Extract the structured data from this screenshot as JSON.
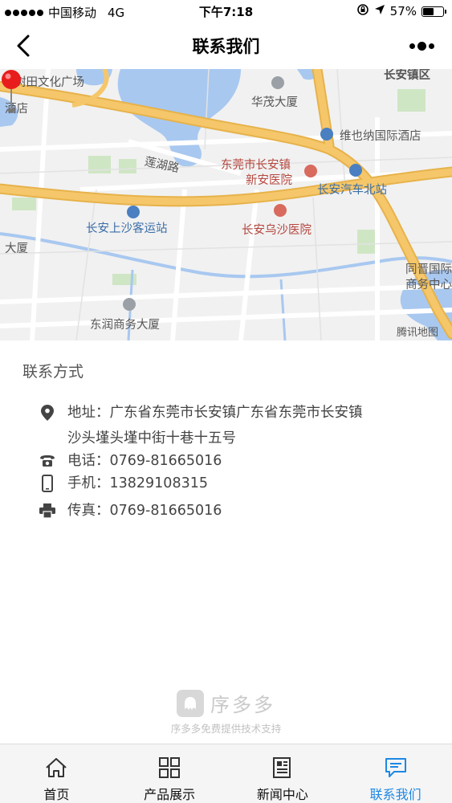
{
  "status_bar": {
    "carrier": "中国移动",
    "network": "4G",
    "time": "下午7:18",
    "battery": "57%",
    "battery_level": 0.57
  },
  "nav": {
    "title": "联系我们",
    "back_icon": "chevron-left-icon",
    "more_icon": "more-dots-icon"
  },
  "map": {
    "labels": [
      {
        "text": "树田文化广场",
        "style": "gray"
      },
      {
        "text": "酒店",
        "style": "gray"
      },
      {
        "text": "华茂大厦",
        "style": "gray"
      },
      {
        "text": "长安镇区",
        "style": "gray"
      },
      {
        "text": "维也纳国际酒店",
        "style": "gray"
      },
      {
        "text": "莲湖路",
        "style": "gray"
      },
      {
        "text": "东莞市长安镇",
        "style": "red"
      },
      {
        "text": "新安医院",
        "style": "red"
      },
      {
        "text": "长安汽车北站",
        "style": "blue"
      },
      {
        "text": "长安上沙客运站",
        "style": "blue"
      },
      {
        "text": "长安乌沙医院",
        "style": "red"
      },
      {
        "text": "大厦",
        "style": "gray"
      },
      {
        "text": "同晋国际",
        "style": "gray"
      },
      {
        "text": "商务中心",
        "style": "gray"
      },
      {
        "text": "东润商务大厦",
        "style": "gray"
      },
      {
        "text": "腾讯地图",
        "style": "gray"
      }
    ]
  },
  "contact": {
    "section_title": "联系方式",
    "address_label": "地址：",
    "address_line1": "广东省东莞市长安镇广东省东莞市长安镇",
    "address_line2": "沙头墐头墐中街十巷十五号",
    "phone_label": "电话：",
    "phone": "0769-81665016",
    "mobile_label": "手机：",
    "mobile": "13829108315",
    "fax_label": "传真：",
    "fax": "0769-81665016"
  },
  "brand": {
    "name": "序多多",
    "tagline": "序多多免费提供技术支持"
  },
  "tabs": [
    {
      "label": "首页",
      "icon": "home-icon"
    },
    {
      "label": "产品展示",
      "icon": "grid-icon"
    },
    {
      "label": "新闻中心",
      "icon": "news-icon"
    },
    {
      "label": "联系我们",
      "icon": "chat-icon"
    }
  ],
  "colors": {
    "accent": "#1e88e5",
    "road_major": "#f5c76a",
    "water": "#a8c8f0"
  }
}
